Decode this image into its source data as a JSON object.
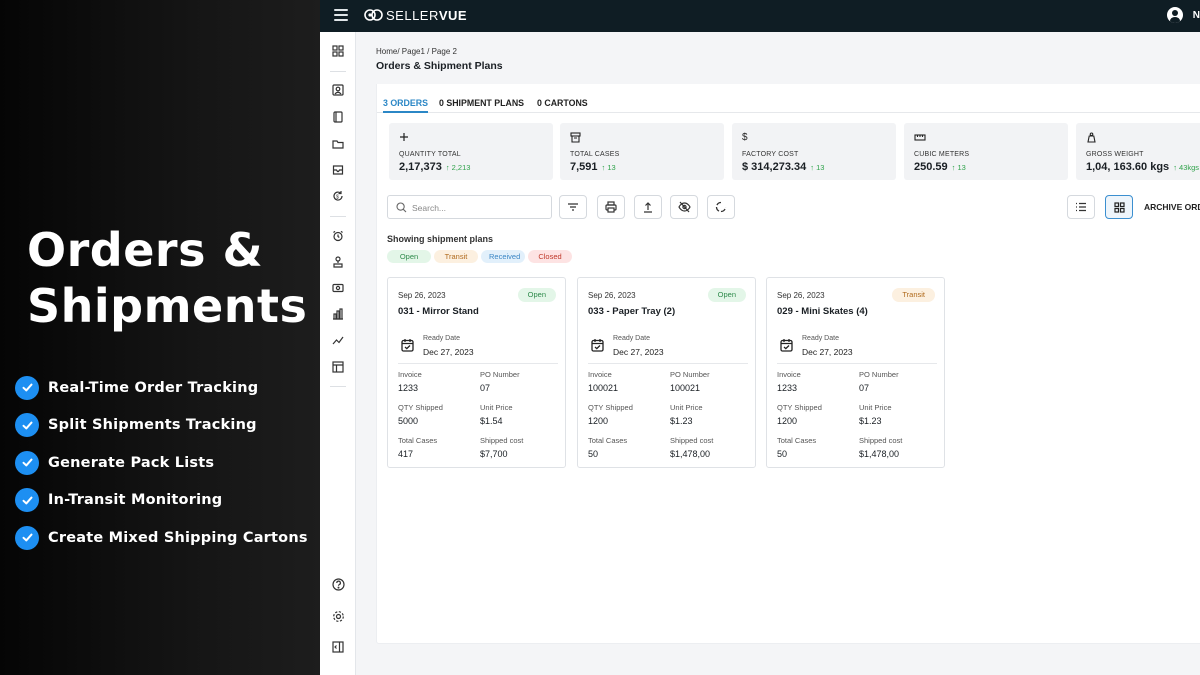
{
  "promo": {
    "title_line1": "Orders &",
    "title_line2": "Shipments",
    "features": [
      "Real-Time Order Tracking",
      "Split Shipments Tracking",
      "Generate Pack Lists",
      "In-Transit Monitoring",
      "Create Mixed Shipping Cartons"
    ],
    "check_color": "#1d8ff2"
  },
  "topbar": {
    "logo_prefix": "SELLER",
    "logo_suffix": "VUE",
    "user_initial": "N"
  },
  "page": {
    "breadcrumb": "Home/ Page1 / Page 2",
    "title": "Orders & Shipment Plans"
  },
  "tabs": [
    {
      "label": "3 ORDERS",
      "active": true
    },
    {
      "label": "0 SHIPMENT PLANS",
      "active": false
    },
    {
      "label": "0 CARTONS",
      "active": false
    }
  ],
  "stats": [
    {
      "icon": "plus-icon",
      "label": "QUANTITY TOTAL",
      "value": "2,17,373",
      "delta": "↑ 2,213"
    },
    {
      "icon": "box-icon",
      "label": "TOTAL CASES",
      "value": "7,591",
      "delta": "↑ 13"
    },
    {
      "icon": "dollar-icon",
      "label": "FACTORY COST",
      "value": "$ 314,273.34",
      "delta": "↑ 13"
    },
    {
      "icon": "ruler-icon",
      "label": "CUBIC METERS",
      "value": "250.59",
      "delta": "↑ 13"
    },
    {
      "icon": "weight-icon",
      "label": "GROSS WEIGHT",
      "value": "1,04, 163.60 kgs",
      "delta": "↑ 43kgs"
    }
  ],
  "toolbar": {
    "search_placeholder": "Search...",
    "archive_label": "ARCHIVE ORD"
  },
  "filters": {
    "heading": "Showing shipment plans",
    "badges": [
      {
        "label": "Open",
        "bg": "#e3f6e8",
        "fg": "#2e8b4b"
      },
      {
        "label": "Transit",
        "bg": "#fcf0e0",
        "fg": "#b06a1c"
      },
      {
        "label": "Received",
        "bg": "#e2f0fb",
        "fg": "#3a86c5"
      },
      {
        "label": "Closed",
        "bg": "#fde3e3",
        "fg": "#c0392b"
      }
    ]
  },
  "cards": [
    {
      "date": "Sep 26, 2023",
      "title": "031 - Mirror Stand",
      "status": "Open",
      "ready_label": "Ready Date",
      "ready_date": "Dec 27, 2023",
      "fields": [
        {
          "label": "Invoice",
          "value": "1233"
        },
        {
          "label": "PO Number",
          "value": "07"
        },
        {
          "label": "QTY Shipped",
          "value": "5000"
        },
        {
          "label": "Unit Price",
          "value": "$1.54"
        },
        {
          "label": "Total Cases",
          "value": "417"
        },
        {
          "label": "Shipped cost",
          "value": "$7,700"
        }
      ]
    },
    {
      "date": "Sep 26, 2023",
      "title": "033 - Paper Tray (2)",
      "status": "Open",
      "ready_label": "Ready Date",
      "ready_date": "Dec 27, 2023",
      "fields": [
        {
          "label": "Invoice",
          "value": "100021"
        },
        {
          "label": "PO Number",
          "value": "100021"
        },
        {
          "label": "QTY Shipped",
          "value": "1200"
        },
        {
          "label": "Unit Price",
          "value": "$1.23"
        },
        {
          "label": "Total Cases",
          "value": "50"
        },
        {
          "label": "Shipped cost",
          "value": "$1,478,00"
        }
      ]
    },
    {
      "date": "Sep 26, 2023",
      "title": "029 - Mini Skates (4)",
      "status": "Transit",
      "ready_label": "Ready Date",
      "ready_date": "Dec 27, 2023",
      "fields": [
        {
          "label": "Invoice",
          "value": "1233"
        },
        {
          "label": "PO Number",
          "value": "07"
        },
        {
          "label": "QTY Shipped",
          "value": "1200"
        },
        {
          "label": "Unit Price",
          "value": "$1.23"
        },
        {
          "label": "Total Cases",
          "value": "50"
        },
        {
          "label": "Shipped cost",
          "value": "$1,478,00"
        }
      ]
    }
  ],
  "colors": {
    "accent": "#2b87c6",
    "topbar": "#0f1d24",
    "open_bg": "#e3f6e8",
    "open_fg": "#2e8b4b",
    "transit_bg": "#fcf0e0",
    "transit_fg": "#b06a1c"
  },
  "sidebar_icons": [
    "dashboard-icon",
    "contact-icon",
    "book-icon",
    "folder-icon",
    "inbox-icon",
    "sync-icon",
    "alarm-icon",
    "stamp-icon",
    "money-icon",
    "bar-chart-icon",
    "trend-icon",
    "table-icon",
    "help-icon",
    "settings-icon",
    "collapse-icon"
  ]
}
